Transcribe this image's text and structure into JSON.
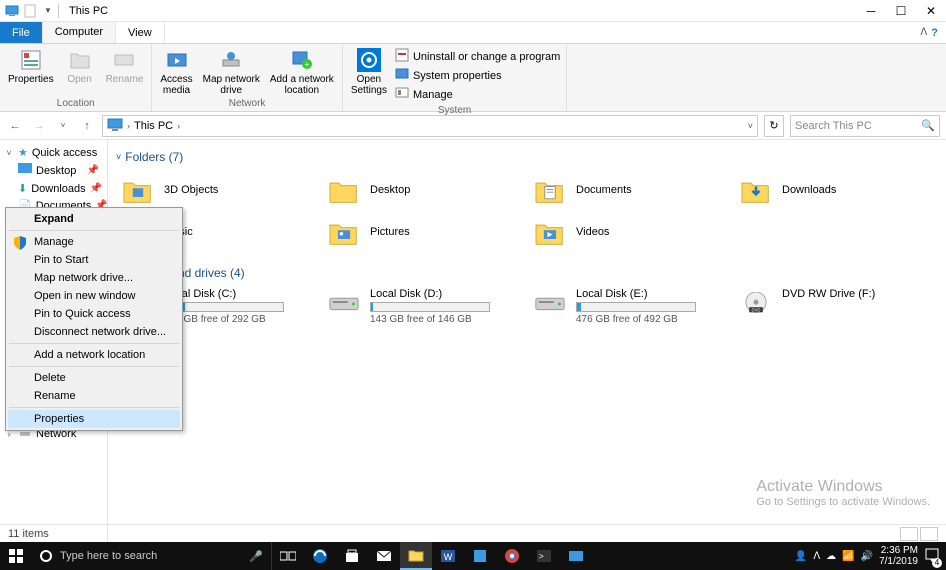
{
  "title": "This PC",
  "tabs": {
    "file": "File",
    "computer": "Computer",
    "view": "View"
  },
  "ribbon": {
    "location": {
      "properties": "Properties",
      "open": "Open",
      "rename": "Rename",
      "label": "Location"
    },
    "network": {
      "access": "Access\nmedia",
      "map": "Map network\ndrive",
      "add": "Add a network\nlocation",
      "label": "Network"
    },
    "settings": {
      "open": "Open\nSettings",
      "label": ""
    },
    "system": {
      "uninstall": "Uninstall or change a program",
      "sysprop": "System properties",
      "manage": "Manage",
      "label": "System"
    }
  },
  "breadcrumb": {
    "root": "This PC"
  },
  "search": {
    "placeholder": "Search This PC"
  },
  "sidebar": {
    "quick_access": "Quick access",
    "items": [
      {
        "label": "Desktop"
      },
      {
        "label": "Downloads"
      },
      {
        "label": "Documents"
      }
    ],
    "network": "Network"
  },
  "sections": {
    "folders": {
      "header": "Folders (7)",
      "items": [
        "3D Objects",
        "Desktop",
        "Documents",
        "Downloads",
        "Music",
        "Pictures",
        "Videos"
      ]
    },
    "drives": {
      "header": "Devices and drives (4)",
      "items": [
        {
          "name": "Local Disk (C:)",
          "free": "242 GB free of 292 GB",
          "pct": 17
        },
        {
          "name": "Local Disk (D:)",
          "free": "143 GB free of 146 GB",
          "pct": 2
        },
        {
          "name": "Local Disk (E:)",
          "free": "476 GB free of 492 GB",
          "pct": 3
        },
        {
          "name": "DVD RW Drive (F:)",
          "free": "",
          "pct": null
        }
      ]
    }
  },
  "context_menu": {
    "expand": "Expand",
    "manage": "Manage",
    "pin_start": "Pin to Start",
    "map_drive": "Map network drive...",
    "open_new": "Open in new window",
    "pin_qa": "Pin to Quick access",
    "disconnect": "Disconnect network drive...",
    "add_loc": "Add a network location",
    "delete": "Delete",
    "rename": "Rename",
    "properties": "Properties"
  },
  "activate": {
    "l1": "Activate Windows",
    "l2": "Go to Settings to activate Windows."
  },
  "status": {
    "items": "11 items"
  },
  "taskbar": {
    "search": "Type here to search",
    "time": "2:36 PM",
    "date": "7/1/2019",
    "notif": "4"
  }
}
